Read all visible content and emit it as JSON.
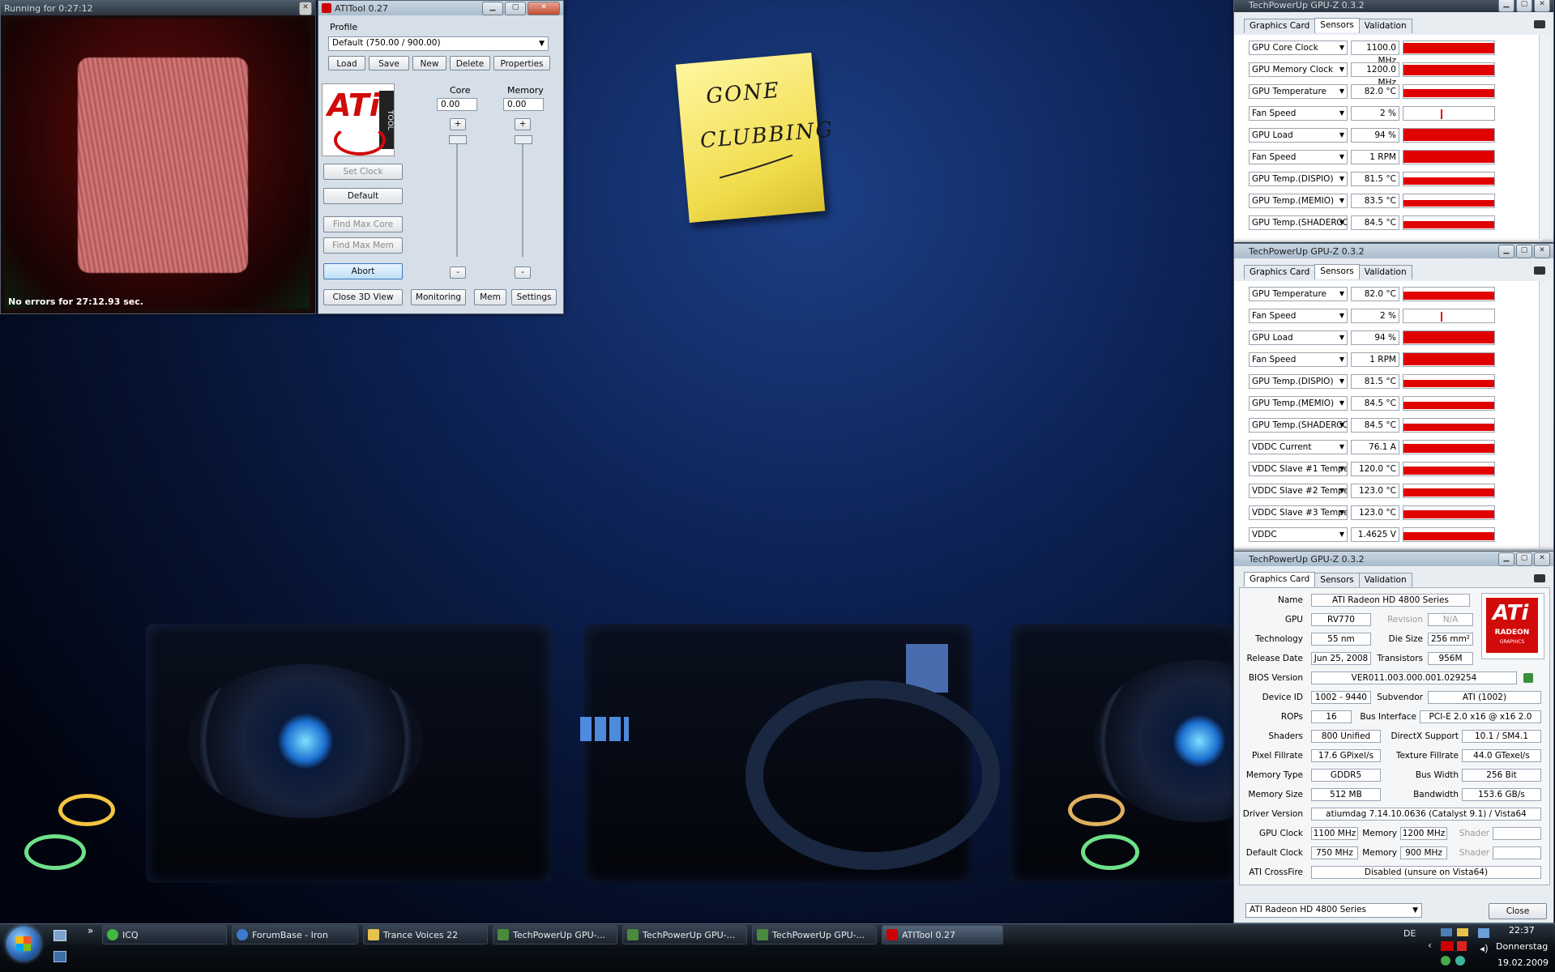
{
  "render_window": {
    "title": "Running for 0:27:12",
    "status": "No errors for 27:12.93 sec."
  },
  "atitool": {
    "title": "ATITool 0.27",
    "profile_label": "Profile",
    "profile_value": "Default (750.00 / 900.00)",
    "profile_buttons": [
      "Load",
      "Save",
      "New",
      "Delete",
      "Properties"
    ],
    "logo_text": "ATi",
    "logo_sub": "TOOL",
    "core_label": "Core",
    "memory_label": "Memory",
    "core_value": "0.00",
    "memory_value": "0.00",
    "plus": "+",
    "minus": "-",
    "set_clock": "Set Clock",
    "default": "Default",
    "find_max_core": "Find Max Core",
    "find_max_mem": "Find Max Mem",
    "abort": "Abort",
    "bottom_buttons": [
      "Close 3D View",
      "Monitoring",
      "Mem",
      "Settings"
    ]
  },
  "note": {
    "line1": "GONE",
    "line2": "CLUBBING"
  },
  "gpuz1": {
    "title": "TechPowerUp GPU-Z 0.3.2",
    "tabs": [
      "Graphics Card",
      "Sensors",
      "Validation"
    ],
    "rows": [
      {
        "name": "GPU Core Clock",
        "value": "1100.0 MHz",
        "level": 0.8
      },
      {
        "name": "GPU Memory Clock",
        "value": "1200.0 MHz",
        "level": 0.8
      },
      {
        "name": "GPU Temperature",
        "value": "82.0 °C",
        "level": 0.6
      },
      {
        "name": "Fan Speed",
        "value": "2 %",
        "level": 0.05
      },
      {
        "name": "GPU Load",
        "value": "94 %",
        "level": 0.94
      },
      {
        "name": "Fan Speed",
        "value": "1 RPM",
        "level": 1.0
      },
      {
        "name": "GPU Temp.(DISPIO)",
        "value": "81.5 °C",
        "level": 0.55
      },
      {
        "name": "GPU Temp.(MEMIO)",
        "value": "83.5 °C",
        "level": 0.5
      },
      {
        "name": "GPU Temp.(SHADERCORE)",
        "value": "84.5 °C",
        "level": 0.55
      }
    ]
  },
  "gpuz2": {
    "title": "TechPowerUp GPU-Z 0.3.2",
    "tabs": [
      "Graphics Card",
      "Sensors",
      "Validation"
    ],
    "rows": [
      {
        "name": "GPU Temperature",
        "value": "82.0 °C",
        "level": 0.6
      },
      {
        "name": "Fan Speed",
        "value": "2 %",
        "level": 0.05
      },
      {
        "name": "GPU Load",
        "value": "94 %",
        "level": 0.94
      },
      {
        "name": "Fan Speed",
        "value": "1 RPM",
        "level": 1.0
      },
      {
        "name": "GPU Temp.(DISPIO)",
        "value": "81.5 °C",
        "level": 0.55
      },
      {
        "name": "GPU Temp.(MEMIO)",
        "value": "84.5 °C",
        "level": 0.55
      },
      {
        "name": "GPU Temp.(SHADERCORE)",
        "value": "84.5 °C",
        "level": 0.55
      },
      {
        "name": "VDDC Current",
        "value": "76.1 A",
        "level": 0.7
      },
      {
        "name": "VDDC Slave #1 Temperature",
        "value": "120.0 °C",
        "level": 0.65
      },
      {
        "name": "VDDC Slave #2 Temperature",
        "value": "123.0 °C",
        "level": 0.65
      },
      {
        "name": "VDDC Slave #3 Temperature",
        "value": "123.0 °C",
        "level": 0.65
      },
      {
        "name": "VDDC",
        "value": "1.4625 V",
        "level": 0.6
      }
    ]
  },
  "gpuz3": {
    "title": "TechPowerUp GPU-Z 0.3.2",
    "tabs": [
      "Graphics Card",
      "Sensors",
      "Validation"
    ],
    "logo_text": "ATi",
    "logo_sub": "RADEON",
    "logo_sub2": "GRAPHICS",
    "labels": {
      "name": "Name",
      "gpu": "GPU",
      "revision": "Revision",
      "technology": "Technology",
      "die_size": "Die Size",
      "release_date": "Release Date",
      "transistors": "Transistors",
      "bios": "BIOS Version",
      "device_id": "Device ID",
      "subvendor": "Subvendor",
      "rops": "ROPs",
      "bus_interface": "Bus Interface",
      "shaders": "Shaders",
      "directx": "DirectX Support",
      "pixel_fillrate": "Pixel Fillrate",
      "texture_fillrate": "Texture Fillrate",
      "memory_type": "Memory Type",
      "bus_width": "Bus Width",
      "memory_size": "Memory Size",
      "bandwidth": "Bandwidth",
      "driver": "Driver Version",
      "gpu_clock": "GPU Clock",
      "memory": "Memory",
      "shader": "Shader",
      "default_clock": "Default Clock",
      "crossfire": "ATI CrossFire"
    },
    "values": {
      "name": "ATI Radeon HD 4800 Series",
      "gpu": "RV770",
      "revision": "N/A",
      "technology": "55 nm",
      "die_size": "256 mm²",
      "release_date": "Jun 25, 2008",
      "transistors": "956M",
      "bios": "VER011.003.000.001.029254",
      "device_id": "1002 - 9440",
      "subvendor": "ATI (1002)",
      "rops": "16",
      "bus_interface": "PCI-E 2.0 x16 @ x16 2.0",
      "shaders": "800 Unified",
      "directx": "10.1 / SM4.1",
      "pixel_fillrate": "17.6 GPixel/s",
      "texture_fillrate": "44.0 GTexel/s",
      "memory_type": "GDDR5",
      "bus_width": "256 Bit",
      "memory_size": "512 MB",
      "bandwidth": "153.6 GB/s",
      "driver": "atiumdag 7.14.10.0636 (Catalyst 9.1) / Vista64",
      "gpu_clock": "1100 MHz",
      "gpu_memory": "1200 MHz",
      "gpu_shader": "",
      "default_clock": "750 MHz",
      "default_memory": "900 MHz",
      "default_shader": "",
      "crossfire": "Disabled (unsure on Vista64)"
    },
    "card_select": "ATI Radeon HD 4800 Series",
    "close": "Close"
  },
  "taskbar": {
    "items": [
      "ICQ",
      "ForumBase - Iron",
      "Trance Voices 22",
      "TechPowerUp GPU-...",
      "TechPowerUp GPU-...",
      "TechPowerUp GPU-...",
      "ATITool 0.27"
    ],
    "lang": "DE",
    "time": "22:37",
    "day": "Donnerstag",
    "date": "19.02.2009",
    "overflow": "»"
  },
  "colors": {
    "sensor_bar": "#e00000",
    "ati_red": "#d10a0a"
  }
}
